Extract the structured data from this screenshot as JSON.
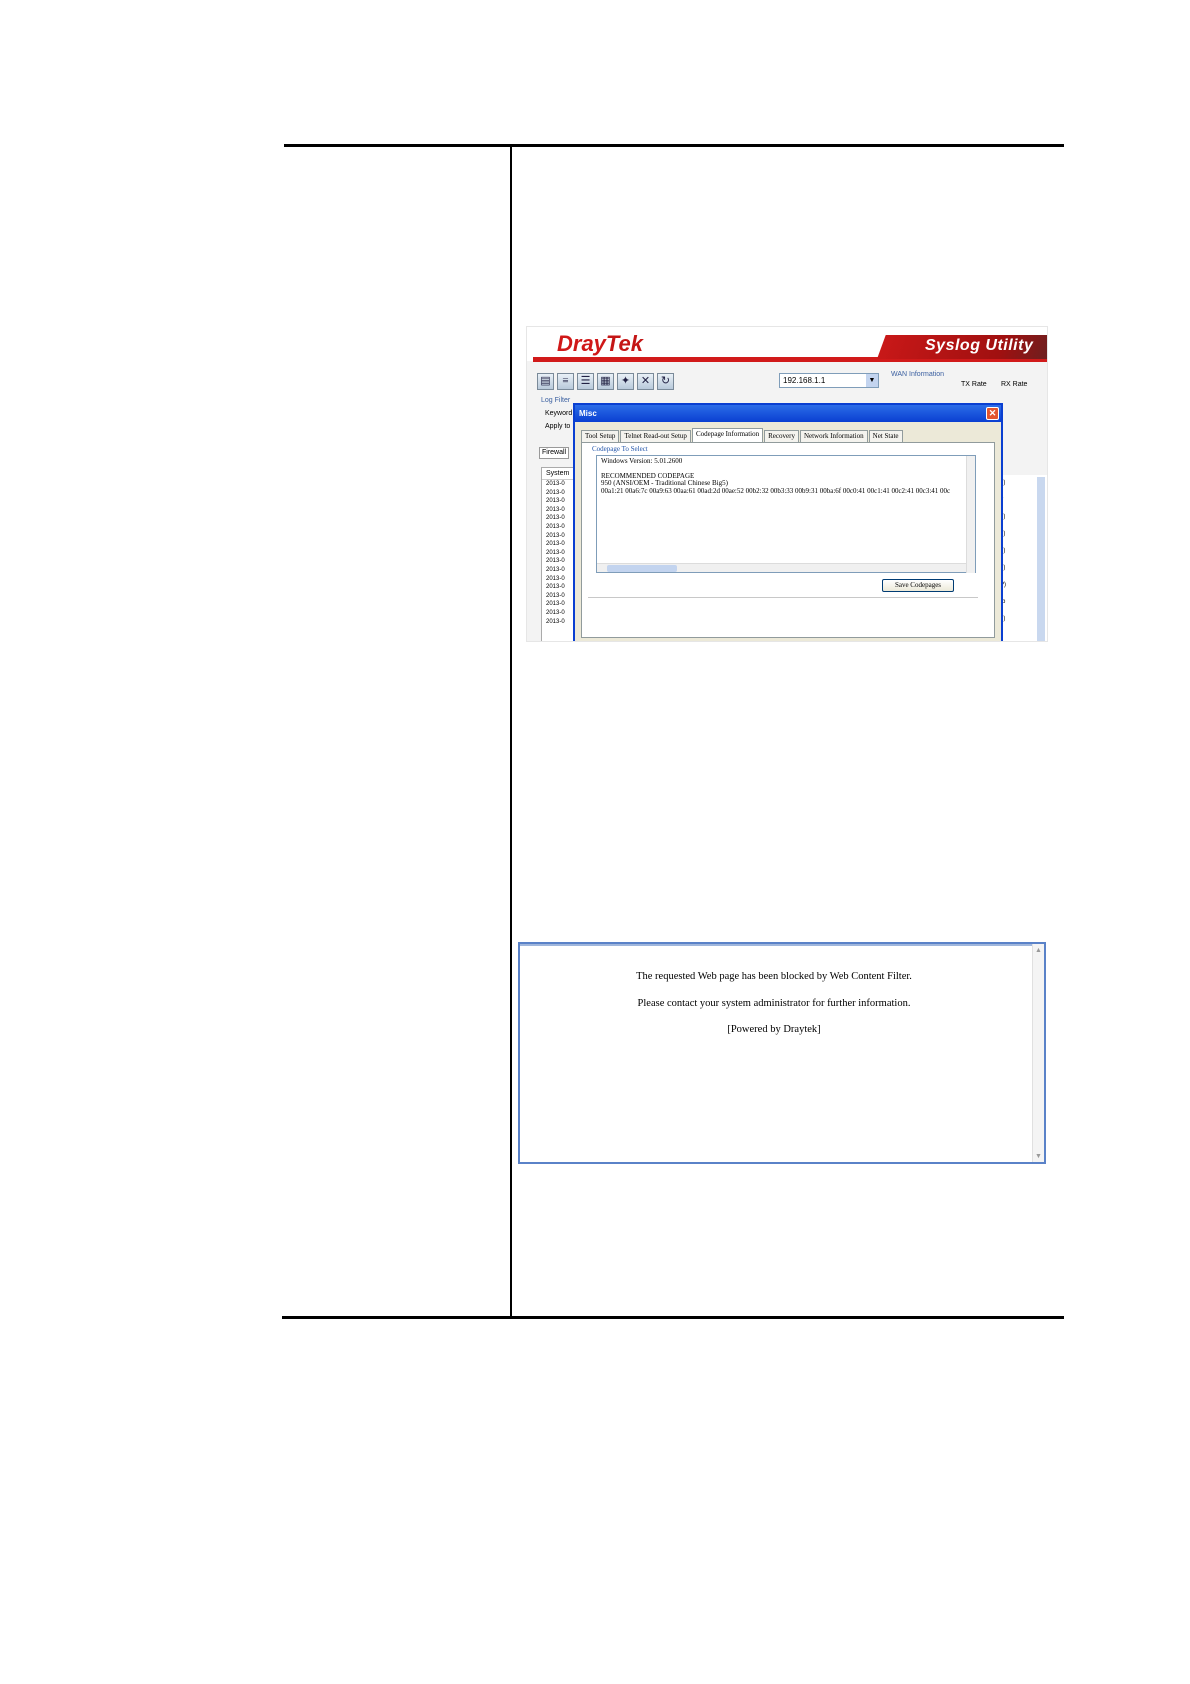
{
  "syslog": {
    "brand_dray": "Dray",
    "brand_tek": "Tek",
    "app_title": "Syslog Utility",
    "ip_value": "192.168.1.1",
    "wan_label": "WAN Information",
    "tx_label": "TX Rate",
    "rx_label": "RX Rate",
    "log_filter_label": "Log Filter",
    "keyword_label": "Keyword",
    "apply_label": "Apply to",
    "firewall_tab": "Firewall",
    "log_header": "System",
    "log_rows": [
      "2013-0",
      "2013-0",
      "2013-0",
      "2013-0",
      "2013-0",
      "2013-0",
      "2013-0",
      "2013-0",
      "2013-0",
      "2013-0",
      "2013-0",
      "2013-0",
      "2013-0",
      "2013-0",
      "2013-0",
      "2013-0",
      "2013-0"
    ],
    "right_rows": [
      "?)",
      "?",
      "?)",
      "?)",
      "?)",
      "?)",
      "P)",
      "rb",
      "?)"
    ]
  },
  "misc_dialog": {
    "title": "Misc",
    "tabs": [
      "Tool Setup",
      "Telnet Read-out Setup",
      "Codepage Information",
      "Recovery",
      "Network Information",
      "Net State"
    ],
    "active_tab": 2,
    "group_label": "Codepage To Select",
    "codepage_lines": [
      "Windows Version: 5.01.2600",
      "",
      "RECOMMENDED CODEPAGE",
      "950   (ANSI/OEM - Traditional Chinese Big5)",
      "00a1:21 00a6:7c 00a9:63 00aa:61 00ad:2d 00ae:52 00b2:32 00b3:33 00b9:31 00ba:6f 00c0:41 00c1:41 00c2:41 00c3:41 00c"
    ],
    "save_button": "Save Codepages"
  },
  "blocked_page": {
    "line1": "The requested Web page has been blocked by Web Content Filter.",
    "line2": "Please contact your system administrator for further information.",
    "line3": "[Powered by Draytek]"
  }
}
